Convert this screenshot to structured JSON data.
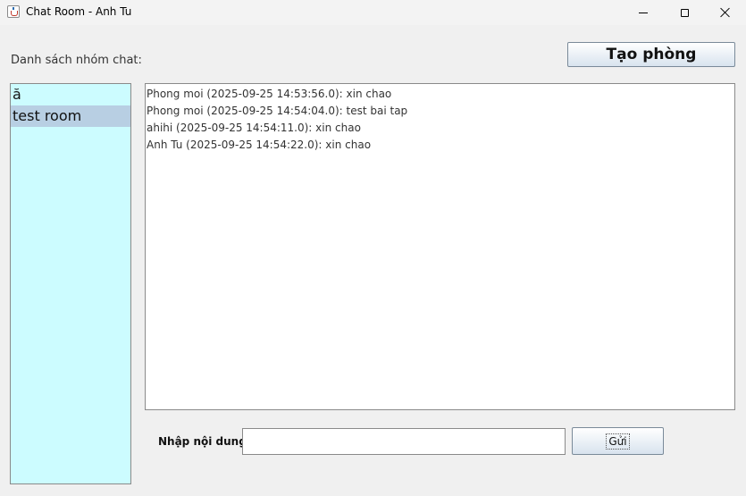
{
  "window": {
    "title": "Chat Room - Anh Tu",
    "icon": "java-cup-icon"
  },
  "sidebar": {
    "label": "Danh sách nhóm chat:",
    "rooms": [
      {
        "label": "ă",
        "selected": false
      },
      {
        "label": "test room",
        "selected": true
      }
    ]
  },
  "toolbar": {
    "create_room_label": "Tạo phòng"
  },
  "chat": {
    "messages": [
      "Phong moi (2025-09-25 14:53:56.0): xin chao",
      "Phong moi (2025-09-25 14:54:04.0): test bai tap",
      "ahihi (2025-09-25 14:54:11.0): xin chao",
      "Anh Tu (2025-09-25 14:54:22.0): xin chao"
    ]
  },
  "composer": {
    "label": "Nhập nội dung",
    "input_value": "",
    "send_label": "Gửi"
  },
  "colors": {
    "room_list_bg": "#ccfcff",
    "selected_room_bg": "#b8cfe3"
  }
}
